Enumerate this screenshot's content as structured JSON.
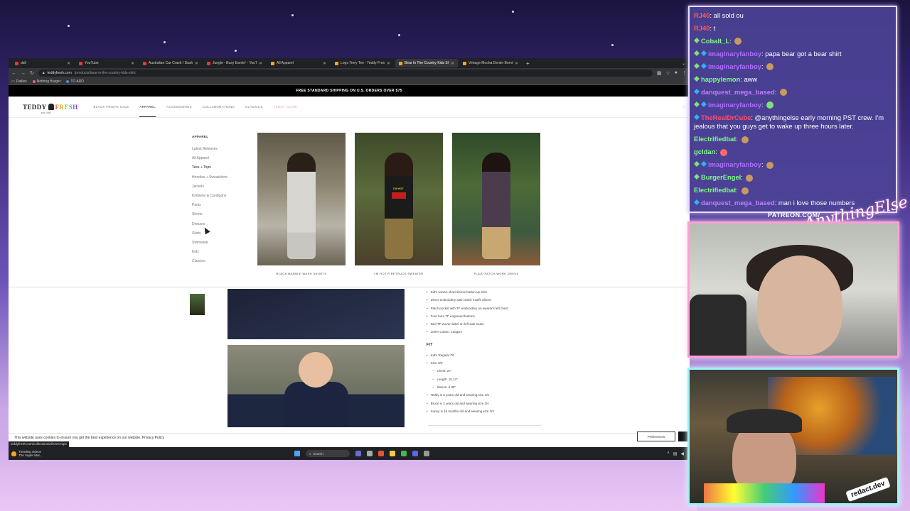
{
  "browser": {
    "tabs": [
      {
        "label": "dall",
        "active": false
      },
      {
        "label": "YouTube",
        "active": false
      },
      {
        "label": "Australian Car Crash / Dash Ca",
        "active": false
      },
      {
        "label": "Jungle - Busy Earnin' - YouTube",
        "active": false
      },
      {
        "label": "All Apparel",
        "active": false
      },
      {
        "label": "Logo Terry Tee - Teddy Fresh",
        "active": false
      },
      {
        "label": "Bear In The Country Kids Shirt",
        "active": true
      },
      {
        "label": "Vintage Mocha Denim Bomber",
        "active": false
      }
    ],
    "new_tab": "+",
    "url_domain": "teddyfresh.com",
    "url_path": "/products/bear-in-the-country-kids-shirt",
    "bookmarks": [
      "Dailies",
      "Nothing Burger",
      "TO ADD"
    ],
    "status_url": "teddyfresh.com/collections/all-tees-tops"
  },
  "site": {
    "promo": "FREE STANDARD SHIPPING ON U.S. ORDERS OVER $75",
    "logo_teddy": "TEDDY",
    "logo_fresh": "FRESH",
    "logo_est": "EST. 2017",
    "nav": [
      "BLACK FRIDAY SALE",
      "APPAREL",
      "ACCESSORIES",
      "COLLABORATIONS",
      "CLASSICS",
      "TEDDY GLOW"
    ],
    "menu_heading": "APPAREL",
    "menu_items": [
      "Latest Releases",
      "All Apparel",
      "Tees + Tops",
      "Hoodies + Sweatshirts",
      "Jackets",
      "Knitwear & Cardigans",
      "Pants",
      "Shorts",
      "Dresses",
      "Skirts",
      "Swimwear",
      "Kids",
      "Classics"
    ],
    "featured": [
      {
        "caption": "BLACK MARBLE WASH SHORTS"
      },
      {
        "caption": "I'M HOT FIRETRUCK SWEATER",
        "print": "I'M HOT"
      },
      {
        "caption": "PLAID PATCH-WORK DRESS"
      }
    ],
    "details": [
      "Kid's woven short sleeve button up shirt",
      "Direct embroidery satin stitch motifs allover",
      "Patch pocket with TF embroidery on wearer's left chest",
      "Four horn TF engraved buttons",
      "Red TF woven label on left side seam",
      "100% Cotton, 120gsm"
    ],
    "fit_heading": "FIT",
    "fit": [
      {
        "text": "Kid's Regular Fit",
        "sub": false
      },
      {
        "text": "Size 4/5:",
        "sub": false
      },
      {
        "text": "Chest: 27\"",
        "sub": true
      },
      {
        "text": "Length: 15.13\"",
        "sub": true
      },
      {
        "text": "Sleeve: 5.38\"",
        "sub": true
      },
      {
        "text": "Teddy is 6 years old and wearing size 4/5",
        "sub": false
      },
      {
        "text": "Bruce is 3 years old and wearing size 3/4",
        "sub": false
      },
      {
        "text": "Sunny is 16 months old and wearing size 2/3",
        "sub": false
      }
    ],
    "cookie_text": "This website uses cookies to ensure you get the best experience on our website. Privacy Policy",
    "cookie_pref": "Preferences"
  },
  "taskbar": {
    "news_title": "Trending videos",
    "news_sub": "The Super Mar...",
    "search": "Search"
  },
  "chat": {
    "messages": [
      {
        "user": "RJ40",
        "color": "#ff5a5a",
        "text": "all sold ou",
        "badge": ""
      },
      {
        "user": "RJ40",
        "color": "#ff5a5a",
        "text": "t",
        "badge": ""
      },
      {
        "user": "Cobalt_L",
        "color": "#7dfc8a",
        "text": "",
        "badge": "g",
        "emote": true
      },
      {
        "user": "imaginaryfanboy",
        "color": "#b26bff",
        "text": "papa bear got a bear shirt",
        "badge": "gb"
      },
      {
        "user": "imaginaryfanboy",
        "color": "#b26bff",
        "text": "",
        "badge": "gb",
        "emote": true
      },
      {
        "user": "happylemon",
        "color": "#7dfc8a",
        "text": "aww",
        "badge": "g"
      },
      {
        "user": "danquest_mega_based",
        "color": "#c77dff",
        "text": "",
        "badge": "b",
        "emote": true
      },
      {
        "user": "imaginaryfanboy",
        "color": "#b26bff",
        "text": "",
        "badge": "gb",
        "emote": true
      },
      {
        "user": "TheRealDrCube",
        "color": "#ff4d6d",
        "text": "@anythingelse early morning PST crew. I'm jealous that you guys get to wake up three hours later.",
        "badge": "b"
      },
      {
        "user": "Electrifiedbat",
        "color": "#7dfc8a",
        "text": "",
        "badge": "",
        "emote": true
      },
      {
        "user": "gcldan",
        "color": "#7dfc8a",
        "text": "",
        "badge": "",
        "emote": true
      },
      {
        "user": "imaginaryfanboy",
        "color": "#b26bff",
        "text": "",
        "badge": "gb",
        "emote": true
      },
      {
        "user": "BurgerEngel",
        "color": "#7dfc8a",
        "text": "",
        "badge": "g",
        "emote": true
      },
      {
        "user": "Electrifiedbat",
        "color": "#7dfc8a",
        "text": "",
        "badge": "",
        "emote": true
      },
      {
        "user": "danquest_mega_based",
        "color": "#c77dff",
        "text": "man i love those numbers",
        "badge": "b"
      }
    ],
    "patreon": "PATREON.COM/",
    "script_logo": "AnythingElse",
    "redact": "redact.dev"
  },
  "colors": {
    "chat_bg": "#4c4296",
    "accent_pink": "#ff9fd6",
    "accent_cyan": "#9ff0f4"
  }
}
